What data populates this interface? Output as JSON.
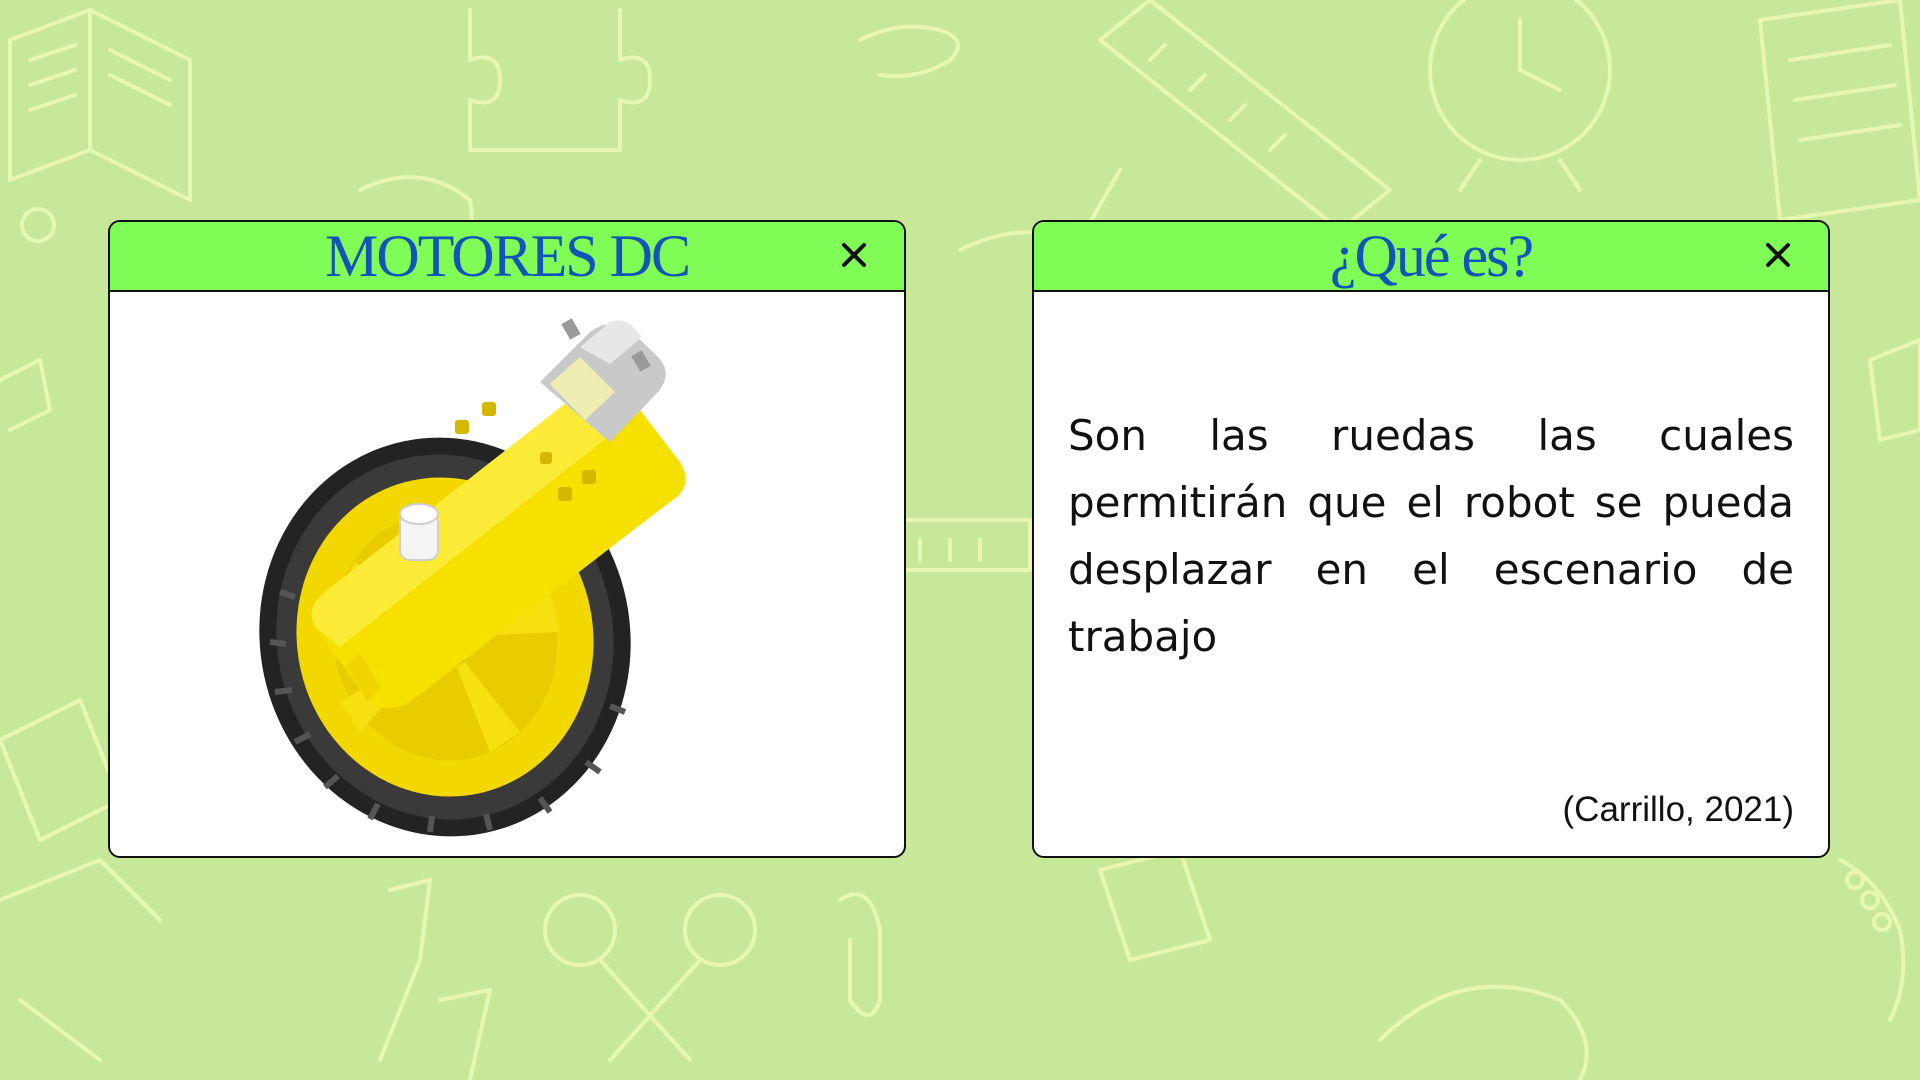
{
  "background_color": "#c8e899",
  "windows": [
    {
      "title": "MOTORES DC",
      "close_icon": "close-icon",
      "image": "yellow-dc-gear-motor-with-wheel"
    },
    {
      "title": "¿Qué es?",
      "close_icon": "close-icon",
      "description": "Son las ruedas las cuales permitirán que el robot se pueda desplazar en el escenario de trabajo",
      "citation": "(Carrillo, 2021)"
    }
  ],
  "colors": {
    "titlebar": "#80fc56",
    "title_text": "#1255b8",
    "window_bg": "#ffffff",
    "border": "#111111"
  }
}
